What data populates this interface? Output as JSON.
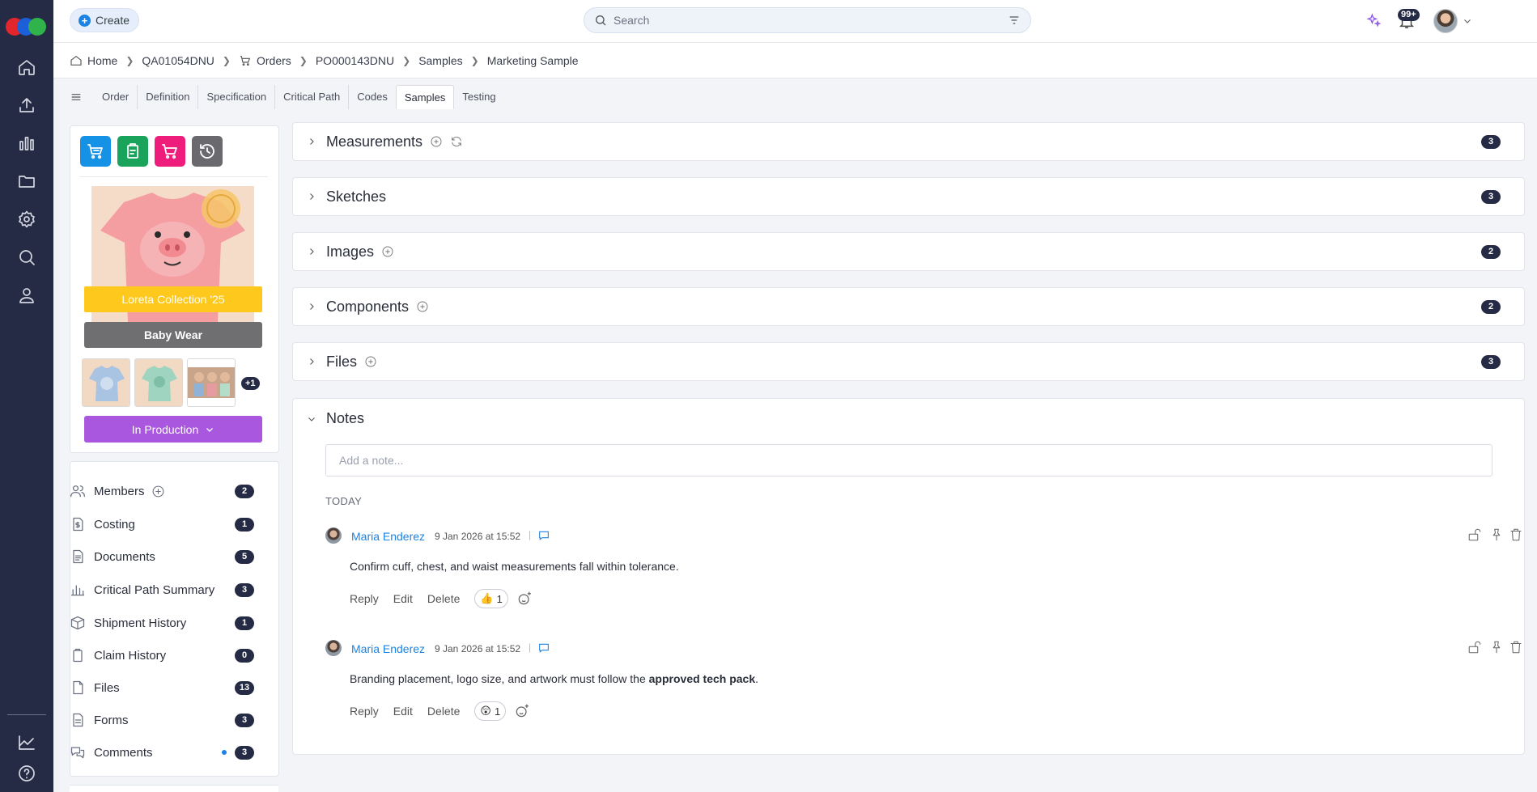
{
  "topbar": {
    "create_label": "Create",
    "search_placeholder": "Search",
    "notifications_count": "99+"
  },
  "breadcrumb": [
    "Home",
    "QA01054DNU",
    "Orders",
    "PO000143DNU",
    "Samples",
    "Marketing Sample"
  ],
  "tabs": [
    "Order",
    "Definition",
    "Specification",
    "Critical Path",
    "Codes",
    "Samples",
    "Testing"
  ],
  "active_tab": "Samples",
  "product": {
    "collection": "Loreta Collection '25",
    "category": "Baby Wear",
    "more_images": "+1",
    "status": "In Production"
  },
  "side_list": [
    {
      "label": "Members",
      "count": "2"
    },
    {
      "label": "Costing",
      "count": "1"
    },
    {
      "label": "Documents",
      "count": "5"
    },
    {
      "label": "Critical Path Summary",
      "count": "3"
    },
    {
      "label": "Shipment History",
      "count": "1"
    },
    {
      "label": "Claim History",
      "count": "0"
    },
    {
      "label": "Files",
      "count": "13"
    },
    {
      "label": "Forms",
      "count": "3"
    },
    {
      "label": "Comments",
      "count": "3"
    }
  ],
  "sections": [
    {
      "title": "Measurements",
      "count": "3"
    },
    {
      "title": "Sketches",
      "count": "3"
    },
    {
      "title": "Images",
      "count": "2"
    },
    {
      "title": "Components",
      "count": "2"
    },
    {
      "title": "Files",
      "count": "3"
    }
  ],
  "notes": {
    "title": "Notes",
    "input_placeholder": "Add a note...",
    "group_label": "TODAY",
    "actions": {
      "reply": "Reply",
      "edit": "Edit",
      "delete": "Delete"
    },
    "items": [
      {
        "author": "Maria Enderez",
        "time": "9 Jan 2026 at 15:52",
        "text": "Confirm cuff, chest, and waist measurements fall within tolerance.",
        "reaction_emoji": "👍",
        "reaction_count": "1"
      },
      {
        "author": "Maria Enderez",
        "time": "9 Jan 2026 at 15:52",
        "text_before": "Branding placement, logo size, and artwork must follow the ",
        "text_bold": "approved tech pack",
        "text_after": ".",
        "reaction_emoji": "😲",
        "reaction_count": "1"
      }
    ]
  },
  "colors": {
    "nav_bg": "#262b45",
    "accent_blue": "#1b83e3",
    "collection_yellow": "#ffc81c",
    "status_purple": "#a857de",
    "tool_blue": "#1592e6",
    "tool_green": "#1aa35b",
    "tool_pink": "#ee1c7b",
    "tool_gray": "#6a6a6e"
  }
}
